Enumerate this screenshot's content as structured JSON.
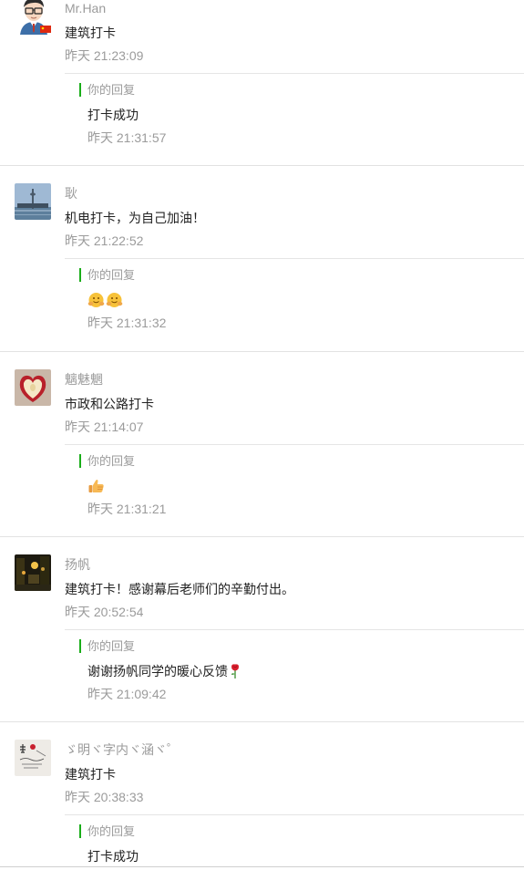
{
  "comments": [
    {
      "avatar": "cartoon-man-avatar",
      "nick": "Mr.Han",
      "text": "建筑打卡",
      "time": "昨天 21:23:09",
      "reply_label": "你的回复",
      "reply_text": "打卡成功",
      "reply_time": "昨天 21:31:57"
    },
    {
      "avatar": "tower-photo-avatar",
      "nick": "耿",
      "text": "机电打卡，为自己加油！",
      "time": "昨天 21:22:52",
      "reply_label": "你的回复",
      "reply_emojis": [
        "hug-emoji",
        "hug-emoji"
      ],
      "reply_time": "昨天 21:31:32"
    },
    {
      "avatar": "apple-photo-avatar",
      "nick": "魑魅魍",
      "text": "市政和公路打卡",
      "time": "昨天 21:14:07",
      "reply_label": "你的回复",
      "reply_emojis": [
        "thumbs-up-emoji"
      ],
      "reply_time": "昨天 21:31:21"
    },
    {
      "avatar": "night-street-avatar",
      "nick": "扬帆",
      "text": "建筑打卡！感谢幕后老师们的辛勤付出。",
      "time": "昨天 20:52:54",
      "reply_label": "你的回复",
      "reply_text": "谢谢扬帆同学的暖心反馈",
      "reply_emojis": [
        "rose-emoji"
      ],
      "reply_time": "昨天 21:09:42"
    },
    {
      "avatar": "handwriting-avatar",
      "nick": "ゞ明ヾ字内ヾ涵ヾ゜",
      "text": "建筑打卡",
      "time": "昨天 20:38:33",
      "reply_label": "你的回复",
      "reply_text": "打卡成功"
    }
  ]
}
